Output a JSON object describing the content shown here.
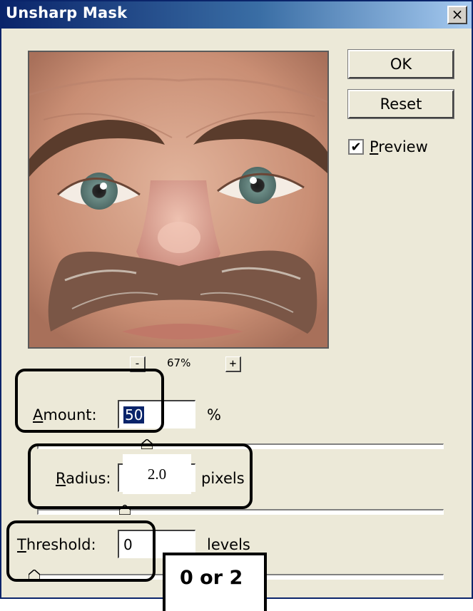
{
  "window": {
    "title": "Unsharp Mask",
    "close_glyph": "×",
    "titlebar_color": "#0a246a"
  },
  "buttons": {
    "ok_label": "OK",
    "reset_label": "Reset"
  },
  "preview": {
    "checkbox_label": "Preview",
    "checked": true,
    "check_glyph": "✔",
    "image_subject": "close-up of a man's face with mustache"
  },
  "zoom": {
    "minus_label": "-",
    "level": "67%",
    "plus_label": "+"
  },
  "amount": {
    "label": "Amount:",
    "value": "50",
    "unit": "%",
    "slider_fraction": 0.3
  },
  "radius": {
    "label": "Radius:",
    "value": "2.0",
    "unit": "pixels",
    "slider_fraction": 0.2
  },
  "threshold": {
    "label": "Threshold:",
    "value": "0",
    "unit": "levels",
    "slider_fraction": 0.0
  },
  "annotation": {
    "note_text": "0 or 2"
  }
}
